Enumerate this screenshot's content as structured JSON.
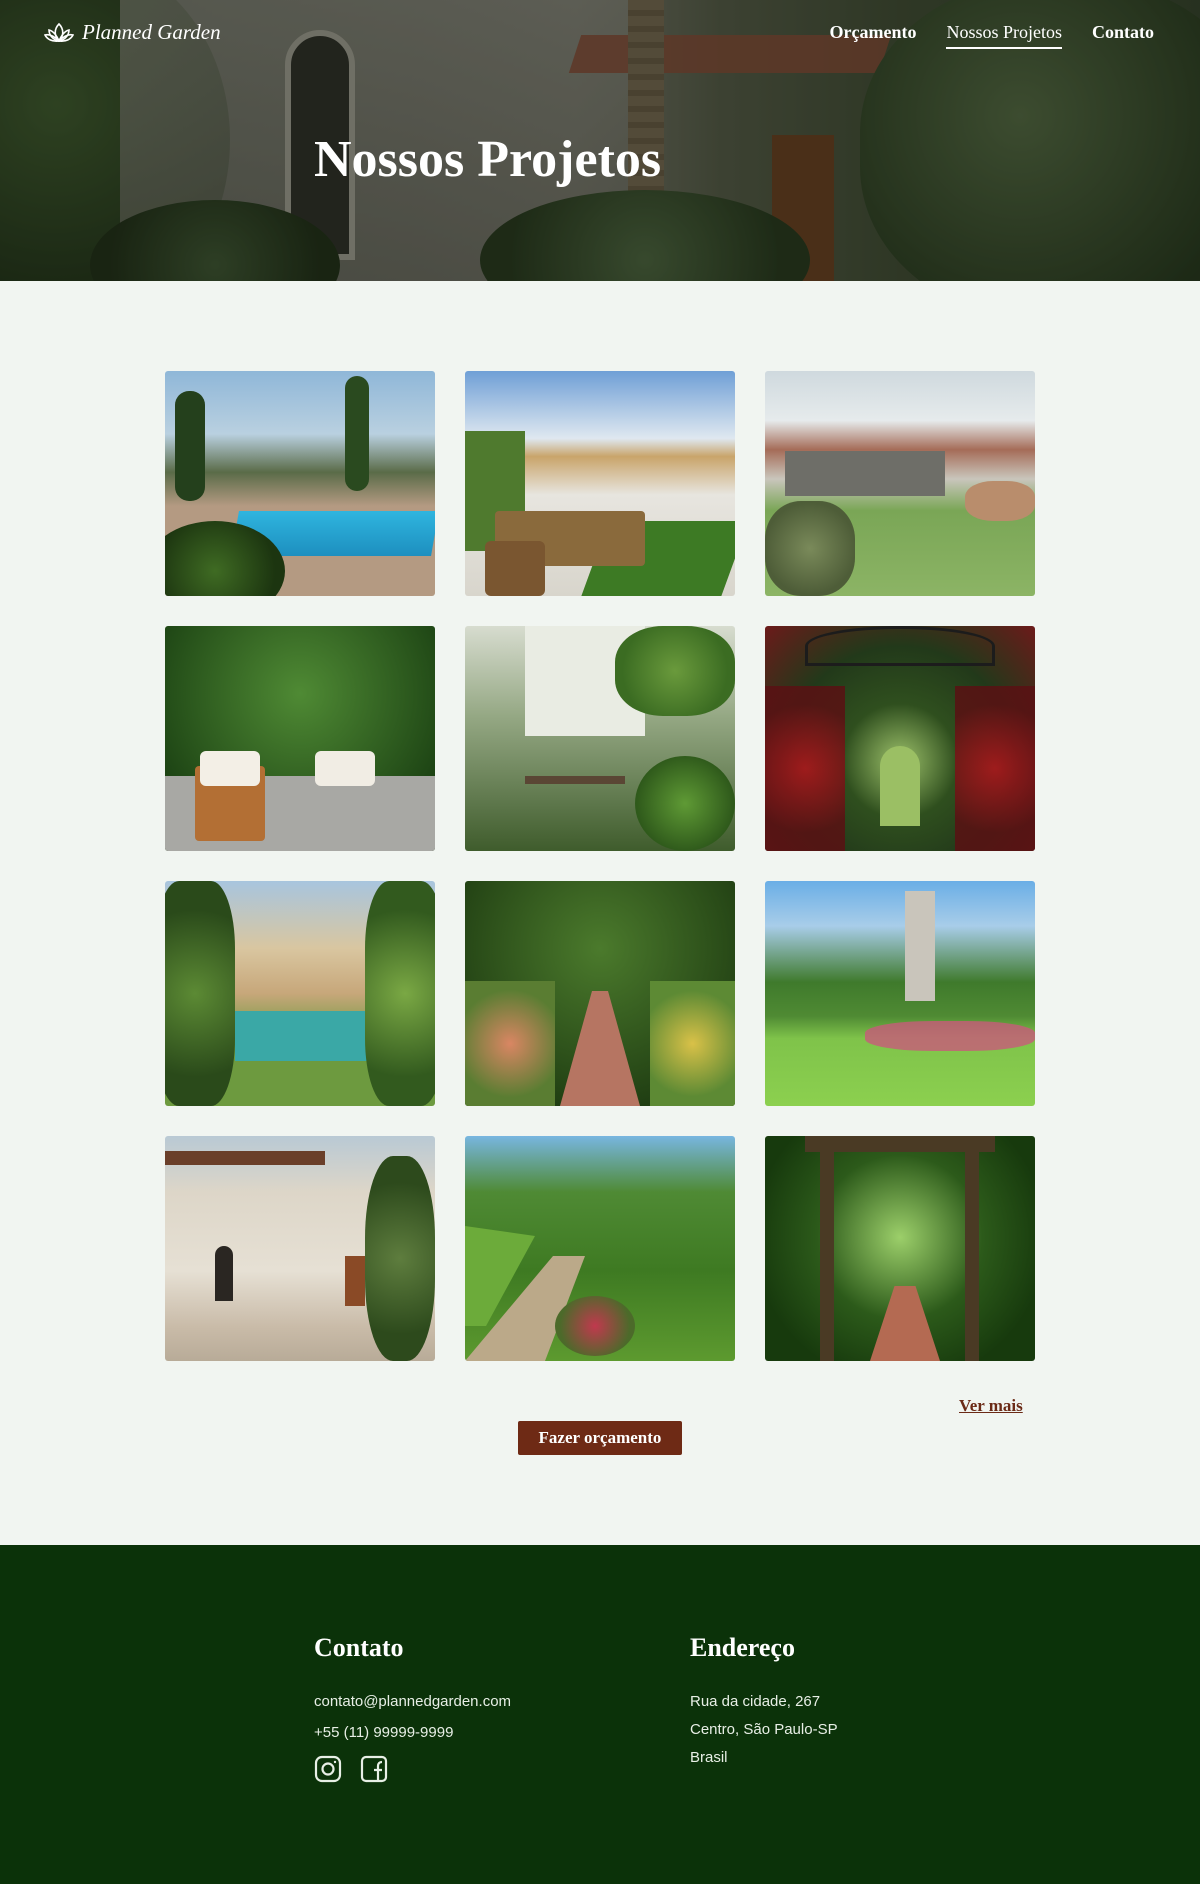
{
  "brand": {
    "name": "Planned Garden",
    "logo_icon": "lotus-icon"
  },
  "nav": {
    "items": [
      {
        "label": "Orçamento",
        "active": false
      },
      {
        "label": "Nossos Projetos",
        "active": true
      },
      {
        "label": "Contato",
        "active": false
      }
    ]
  },
  "hero": {
    "title": "Nossos Projetos"
  },
  "gallery": {
    "images": [
      "pool-garden-photo",
      "patio-dining-photo",
      "desert-lawn-photo",
      "tropical-lounge-photo",
      "courtyard-cafe-photo",
      "rose-arch-photo",
      "villa-pool-photo",
      "brick-path-photo",
      "park-lawn-photo",
      "mediterranean-house-photo",
      "gravel-path-photo",
      "pergola-path-photo"
    ],
    "more_label": "Ver mais",
    "cta_label": "Fazer orçamento"
  },
  "footer": {
    "contact": {
      "title": "Contato",
      "email": "contato@plannedgarden.com",
      "phone": "+55 (11) 99999-9999",
      "icons": [
        "instagram-icon",
        "facebook-icon"
      ]
    },
    "address": {
      "title": "Endereço",
      "line1": "Rua da cidade, 267",
      "line2": "Centro, São Paulo-SP",
      "line3": "Brasil"
    }
  },
  "colors": {
    "accent": "#6e2a15",
    "footer_bg": "#0b3209",
    "page_bg": "#f1f5f1"
  }
}
